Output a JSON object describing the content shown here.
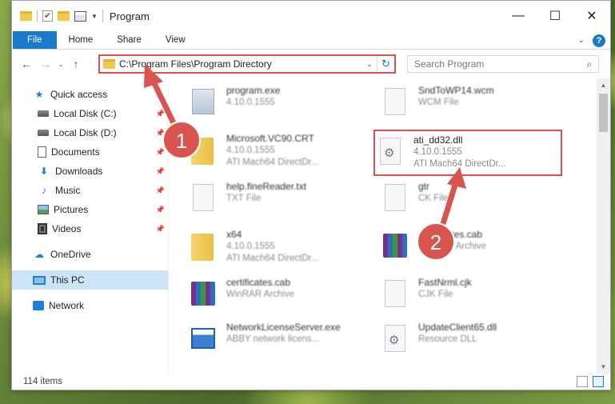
{
  "window": {
    "title": "Program",
    "controls": {
      "minimize": "—",
      "maximize": "☐",
      "close": "✕"
    }
  },
  "ribbon": {
    "tabs": [
      "File",
      "Home",
      "Share",
      "View"
    ],
    "help": "?",
    "expand": "⌄"
  },
  "navigation": {
    "back": "←",
    "forward": "→",
    "recent": "⌄",
    "up": "↑",
    "address": "C:\\Program Files\\Program Directory",
    "address_dropdown": "⌄",
    "refresh": "↻",
    "search_placeholder": "Search Program",
    "search_icon": "⌕"
  },
  "sidebar": {
    "quick_access": "Quick access",
    "items": [
      {
        "label": "Local Disk (C:)",
        "icon": "disk-icon",
        "pinned": true
      },
      {
        "label": "Local Disk (D:)",
        "icon": "disk-icon",
        "pinned": true
      },
      {
        "label": "Documents",
        "icon": "documents-icon",
        "pinned": true
      },
      {
        "label": "Downloads",
        "icon": "downloads-icon",
        "pinned": true
      },
      {
        "label": "Music",
        "icon": "music-icon",
        "pinned": true
      },
      {
        "label": "Pictures",
        "icon": "pictures-icon",
        "pinned": true
      },
      {
        "label": "Videos",
        "icon": "videos-icon",
        "pinned": true
      }
    ],
    "onedrive": "OneDrive",
    "this_pc": "This PC",
    "network": "Network",
    "pin_glyph": "📌"
  },
  "files": [
    {
      "name": "program.exe",
      "meta1": "4.10.0.1555",
      "meta2": "",
      "icon": "exe-icon"
    },
    {
      "name": "SndToWP14.wcm",
      "meta1": "WCM File",
      "meta2": "",
      "icon": "document-icon"
    },
    {
      "name": "Microsoft.VC90.CRT",
      "meta1": "4.10.0.1555",
      "meta2": "ATI Mach64 DirectDr...",
      "icon": "folder-icon"
    },
    {
      "name": "ati_dd32.dll",
      "meta1": "4.10.0.1555",
      "meta2": "ATI Mach64 DirectDr...",
      "icon": "dll-gear-icon",
      "highlighted": true
    },
    {
      "name": "help.fineReader.txt",
      "meta1": "TXT File",
      "meta2": "",
      "icon": "document-icon"
    },
    {
      "name": "gtr",
      "meta1": "CK File",
      "meta2": "",
      "icon": "document-icon"
    },
    {
      "name": "x64",
      "meta1": "4.10.0.1555",
      "meta2": "ATI Mach64 DirectDr...",
      "icon": "folder-icon"
    },
    {
      "name": "certificates.cab",
      "meta1": "WinRAR Archive",
      "meta2": "",
      "icon": "winrar-icon"
    },
    {
      "name": "certificates.cab",
      "meta1": "WinRAR Archive",
      "meta2": "",
      "icon": "winrar-icon"
    },
    {
      "name": "FastNrml.cjk",
      "meta1": "CJK File",
      "meta2": "",
      "icon": "document-icon"
    },
    {
      "name": "NetworkLicenseServer.exe",
      "meta1": "ABBY network licens...",
      "meta2": "",
      "icon": "app-icon"
    },
    {
      "name": "UpdateClient65.dll",
      "meta1": "Resource DLL",
      "meta2": "",
      "icon": "dll-gear-icon"
    }
  ],
  "status": {
    "item_count": "114 items"
  },
  "annotations": {
    "badge1": "1",
    "badge2": "2",
    "color": "#d9534f"
  }
}
